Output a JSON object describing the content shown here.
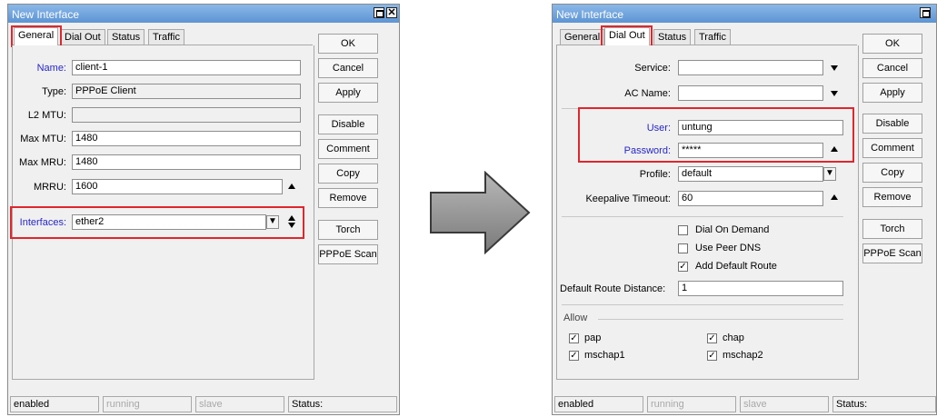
{
  "left_window": {
    "title": "New Interface",
    "tabs": [
      "General",
      "Dial Out",
      "Status",
      "Traffic"
    ],
    "fields": {
      "name_label": "Name:",
      "name_value": "client-1",
      "type_label": "Type:",
      "type_value": "PPPoE Client",
      "l2mtu_label": "L2 MTU:",
      "l2mtu_value": "",
      "maxmtu_label": "Max MTU:",
      "maxmtu_value": "1480",
      "maxmru_label": "Max MRU:",
      "maxmru_value": "1480",
      "mrru_label": "MRRU:",
      "mrru_value": "1600",
      "interfaces_label": "Interfaces:",
      "interfaces_value": "ether2"
    },
    "buttons": [
      "OK",
      "Cancel",
      "Apply",
      "Disable",
      "Comment",
      "Copy",
      "Remove",
      "Torch",
      "PPPoE Scan"
    ],
    "status": [
      "enabled",
      "running",
      "slave",
      "Status:"
    ]
  },
  "right_window": {
    "title": "New Interface",
    "tabs": [
      "General",
      "Dial Out",
      "Status",
      "Traffic"
    ],
    "fields": {
      "service_label": "Service:",
      "service_value": "",
      "acname_label": "AC Name:",
      "acname_value": "",
      "user_label": "User:",
      "user_value": "untung",
      "password_label": "Password:",
      "password_value": "*****",
      "profile_label": "Profile:",
      "profile_value": "default",
      "keepalive_label": "Keepalive Timeout:",
      "keepalive_value": "60",
      "route_distance_label": "Default Route Distance:",
      "route_distance_value": "1",
      "allow_label": "Allow"
    },
    "checkboxes": {
      "dial_on_demand": {
        "label": "Dial On Demand",
        "checked": false
      },
      "use_peer_dns": {
        "label": "Use Peer DNS",
        "checked": false
      },
      "add_default_route": {
        "label": "Add Default Route",
        "checked": true
      },
      "pap": {
        "label": "pap",
        "checked": true
      },
      "chap": {
        "label": "chap",
        "checked": true
      },
      "mschap1": {
        "label": "mschap1",
        "checked": true
      },
      "mschap2": {
        "label": "mschap2",
        "checked": true
      }
    },
    "buttons": [
      "OK",
      "Cancel",
      "Apply",
      "Disable",
      "Comment",
      "Copy",
      "Remove",
      "Torch",
      "PPPoE Scan"
    ],
    "status": [
      "enabled",
      "running",
      "slave",
      "Status:"
    ]
  },
  "colors": {
    "highlight": "#e0262d",
    "titlebar": "#5d94d4",
    "blue_label": "#2626c8"
  }
}
